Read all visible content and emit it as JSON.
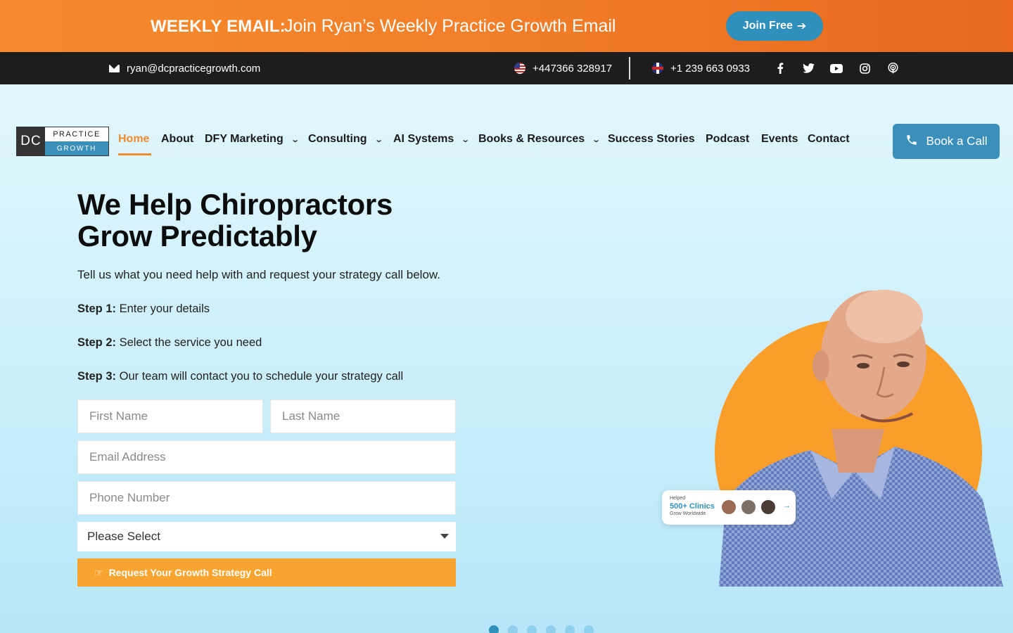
{
  "promo": {
    "strong": "WEEKLY EMAIL:",
    "text": "Join Ryan’s Weekly Practice Growth Email",
    "join_label": "Join Free"
  },
  "contact": {
    "email": "ryan@dcpracticegrowth.com",
    "phone_us": "+447366 328917",
    "phone_uk": "+1 239 663 0933"
  },
  "social": [
    "facebook-icon",
    "twitter-icon",
    "youtube-icon",
    "instagram-icon",
    "podcast-icon"
  ],
  "logo": {
    "dc": "DC",
    "top": "PRACTICE",
    "bottom": "GROWTH"
  },
  "nav": {
    "items": [
      {
        "label": "Home"
      },
      {
        "label": "About"
      },
      {
        "label": "DFY Marketing"
      },
      {
        "label": "Consulting"
      },
      {
        "label": "AI Systems"
      },
      {
        "label": "Books & Resources"
      },
      {
        "label": "Success Stories"
      },
      {
        "label": "Podcast"
      },
      {
        "label": "Events"
      },
      {
        "label": "Contact"
      }
    ],
    "book_label": "Book a Call"
  },
  "hero": {
    "title_line1": "We Help Chiropractors",
    "title_line2": "Grow Predictably",
    "subtitle": "Tell us what you need help with and request your strategy call below.",
    "steps": [
      {
        "label": "Step 1:",
        "text": "Enter your details"
      },
      {
        "label": "Step 2:",
        "text": "Select the service you need"
      },
      {
        "label": "Step 3:",
        "text": "Our team will contact you to schedule your strategy call"
      }
    ]
  },
  "form": {
    "first_name": "First Name",
    "last_name": "Last Name",
    "email": "Email Address",
    "phone": "Phone Number",
    "select_value": "Please Select",
    "submit_label": "Request Your Growth Strategy Call"
  },
  "badge": {
    "helped": "Helped",
    "count": "500+ Clinics",
    "sub": "Grow Worldwide"
  },
  "carousel": {
    "slides": 6,
    "active": 1
  },
  "colors": {
    "accent_orange": "#f08a2d",
    "accent_blue": "#3b8fbb",
    "submit_orange": "#f7a530"
  }
}
